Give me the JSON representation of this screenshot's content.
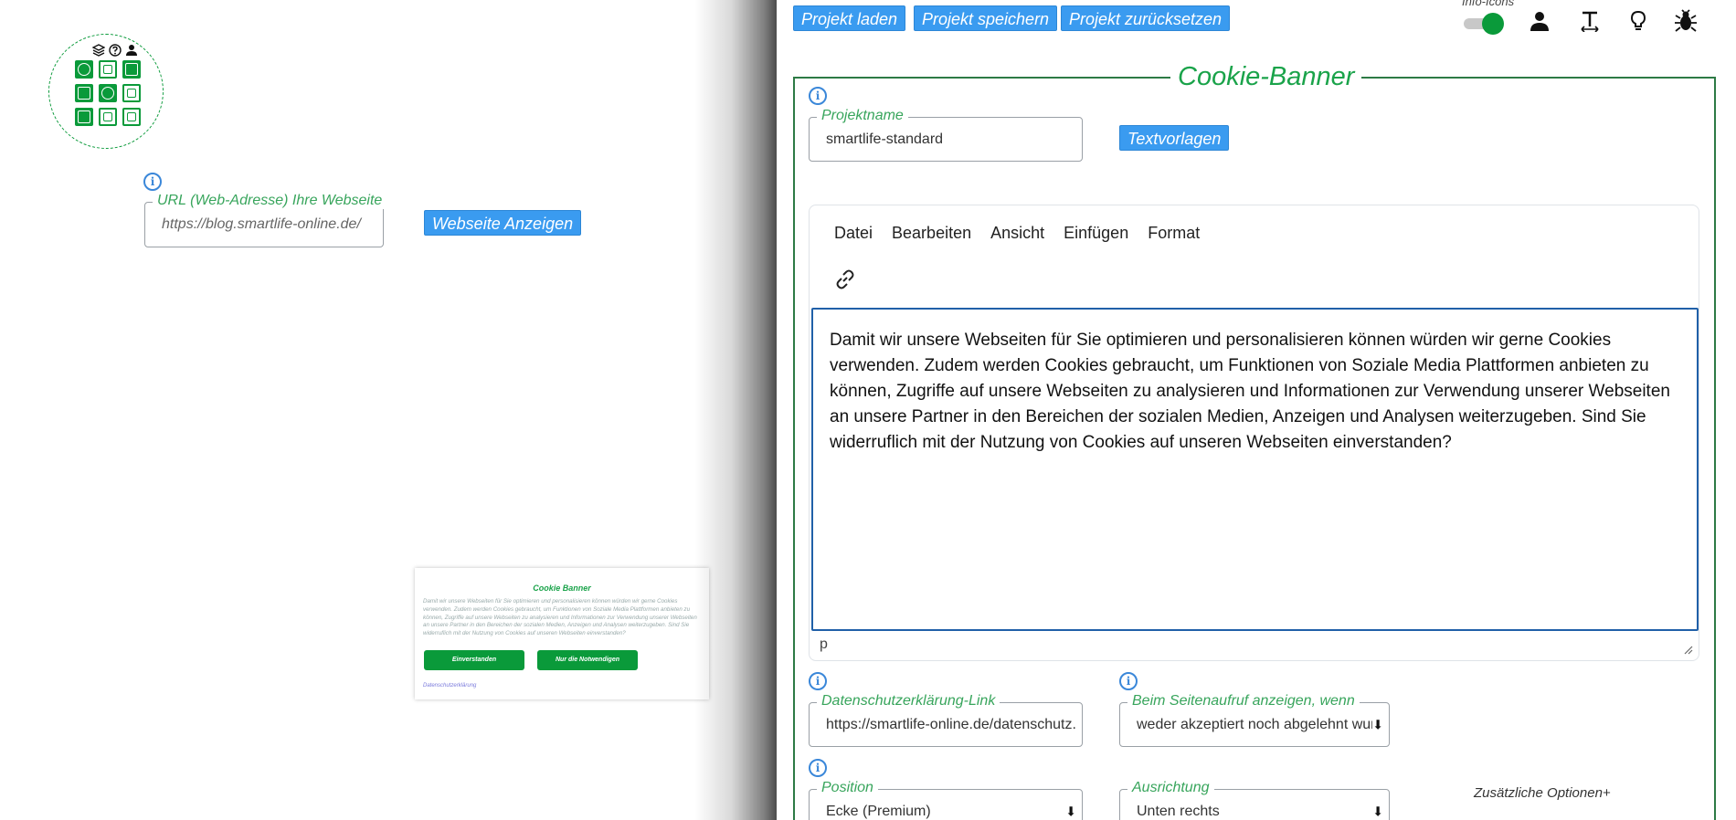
{
  "left": {
    "url_legend": "URL (Web-Adresse) Ihre Webseite",
    "url_placeholder": "https://blog.smartlife-online.de/",
    "show_site_button": "Webseite Anzeigen"
  },
  "preview": {
    "title": "Cookie Banner",
    "text": "Damit wir unsere Webseiten für Sie optimieren und personalisieren können würden wir gerne Cookies verwenden. Zudem werden Cookies gebraucht, um Funktionen von Soziale Media Plattformen anbieten zu können, Zugriffe auf unsere Webseiten zu analysieren und Informationen zur Verwendung unserer Webseiten an unsere Partner in den Bereichen der sozialen Medien, Anzeigen und Analysen weiterzugeben. Sind Sie widerruflich mit der Nutzung von Cookies auf unseren Webseiten einverstanden?",
    "accept_button": "Einverstanden",
    "necessary_button": "Nur die Notwendigen",
    "privacy_link": "Datenschutzerklärung"
  },
  "toolbar": {
    "load": "Projekt laden",
    "save": "Projekt speichern",
    "reset": "Projekt zurücksetzen",
    "info_icons_label": "Info-Icons",
    "info_icons_on": true
  },
  "panel": {
    "title": "Cookie-Banner",
    "project_name_legend": "Projektname",
    "project_name_value": "smartlife-standard",
    "templates_button": "Textvorlagen",
    "editor": {
      "menu": [
        "Datei",
        "Bearbeiten",
        "Ansicht",
        "Einfügen",
        "Format"
      ],
      "content": "Damit wir unsere Webseiten für Sie optimieren und personalisieren können würden wir gerne Cookies verwenden. Zudem werden Cookies gebraucht, um Funktionen von Soziale Media Plattformen anbieten zu können, Zugriffe auf unsere Webseiten zu analysieren und Informationen zur Verwendung unserer Webseiten an unsere Partner in den Bereichen der sozialen Medien, Anzeigen und Analysen weiterzugeben. Sind Sie widerruflich mit der Nutzung von Cookies auf unseren Webseiten einverstanden?",
      "status_path": "p"
    },
    "privacy_link_legend": "Datenschutzerklärung-Link",
    "privacy_link_value": "https://smartlife-online.de/datenschutz.html",
    "show_when_legend": "Beim Seitenaufruf anzeigen, wenn",
    "show_when_value": "weder akzeptiert noch abgelehnt wurde",
    "position_legend": "Position",
    "position_value": "Ecke (Premium)",
    "alignment_legend": "Ausrichtung",
    "alignment_value": "Unten rechts",
    "extra_options": "Zusätzliche Optionen+"
  },
  "colors": {
    "brand_green": "#0a9a3a",
    "title_green": "#1aa34a",
    "button_blue": "#3a9bf0",
    "info_blue": "#3a87d9",
    "editor_focus": "#2060a8"
  }
}
